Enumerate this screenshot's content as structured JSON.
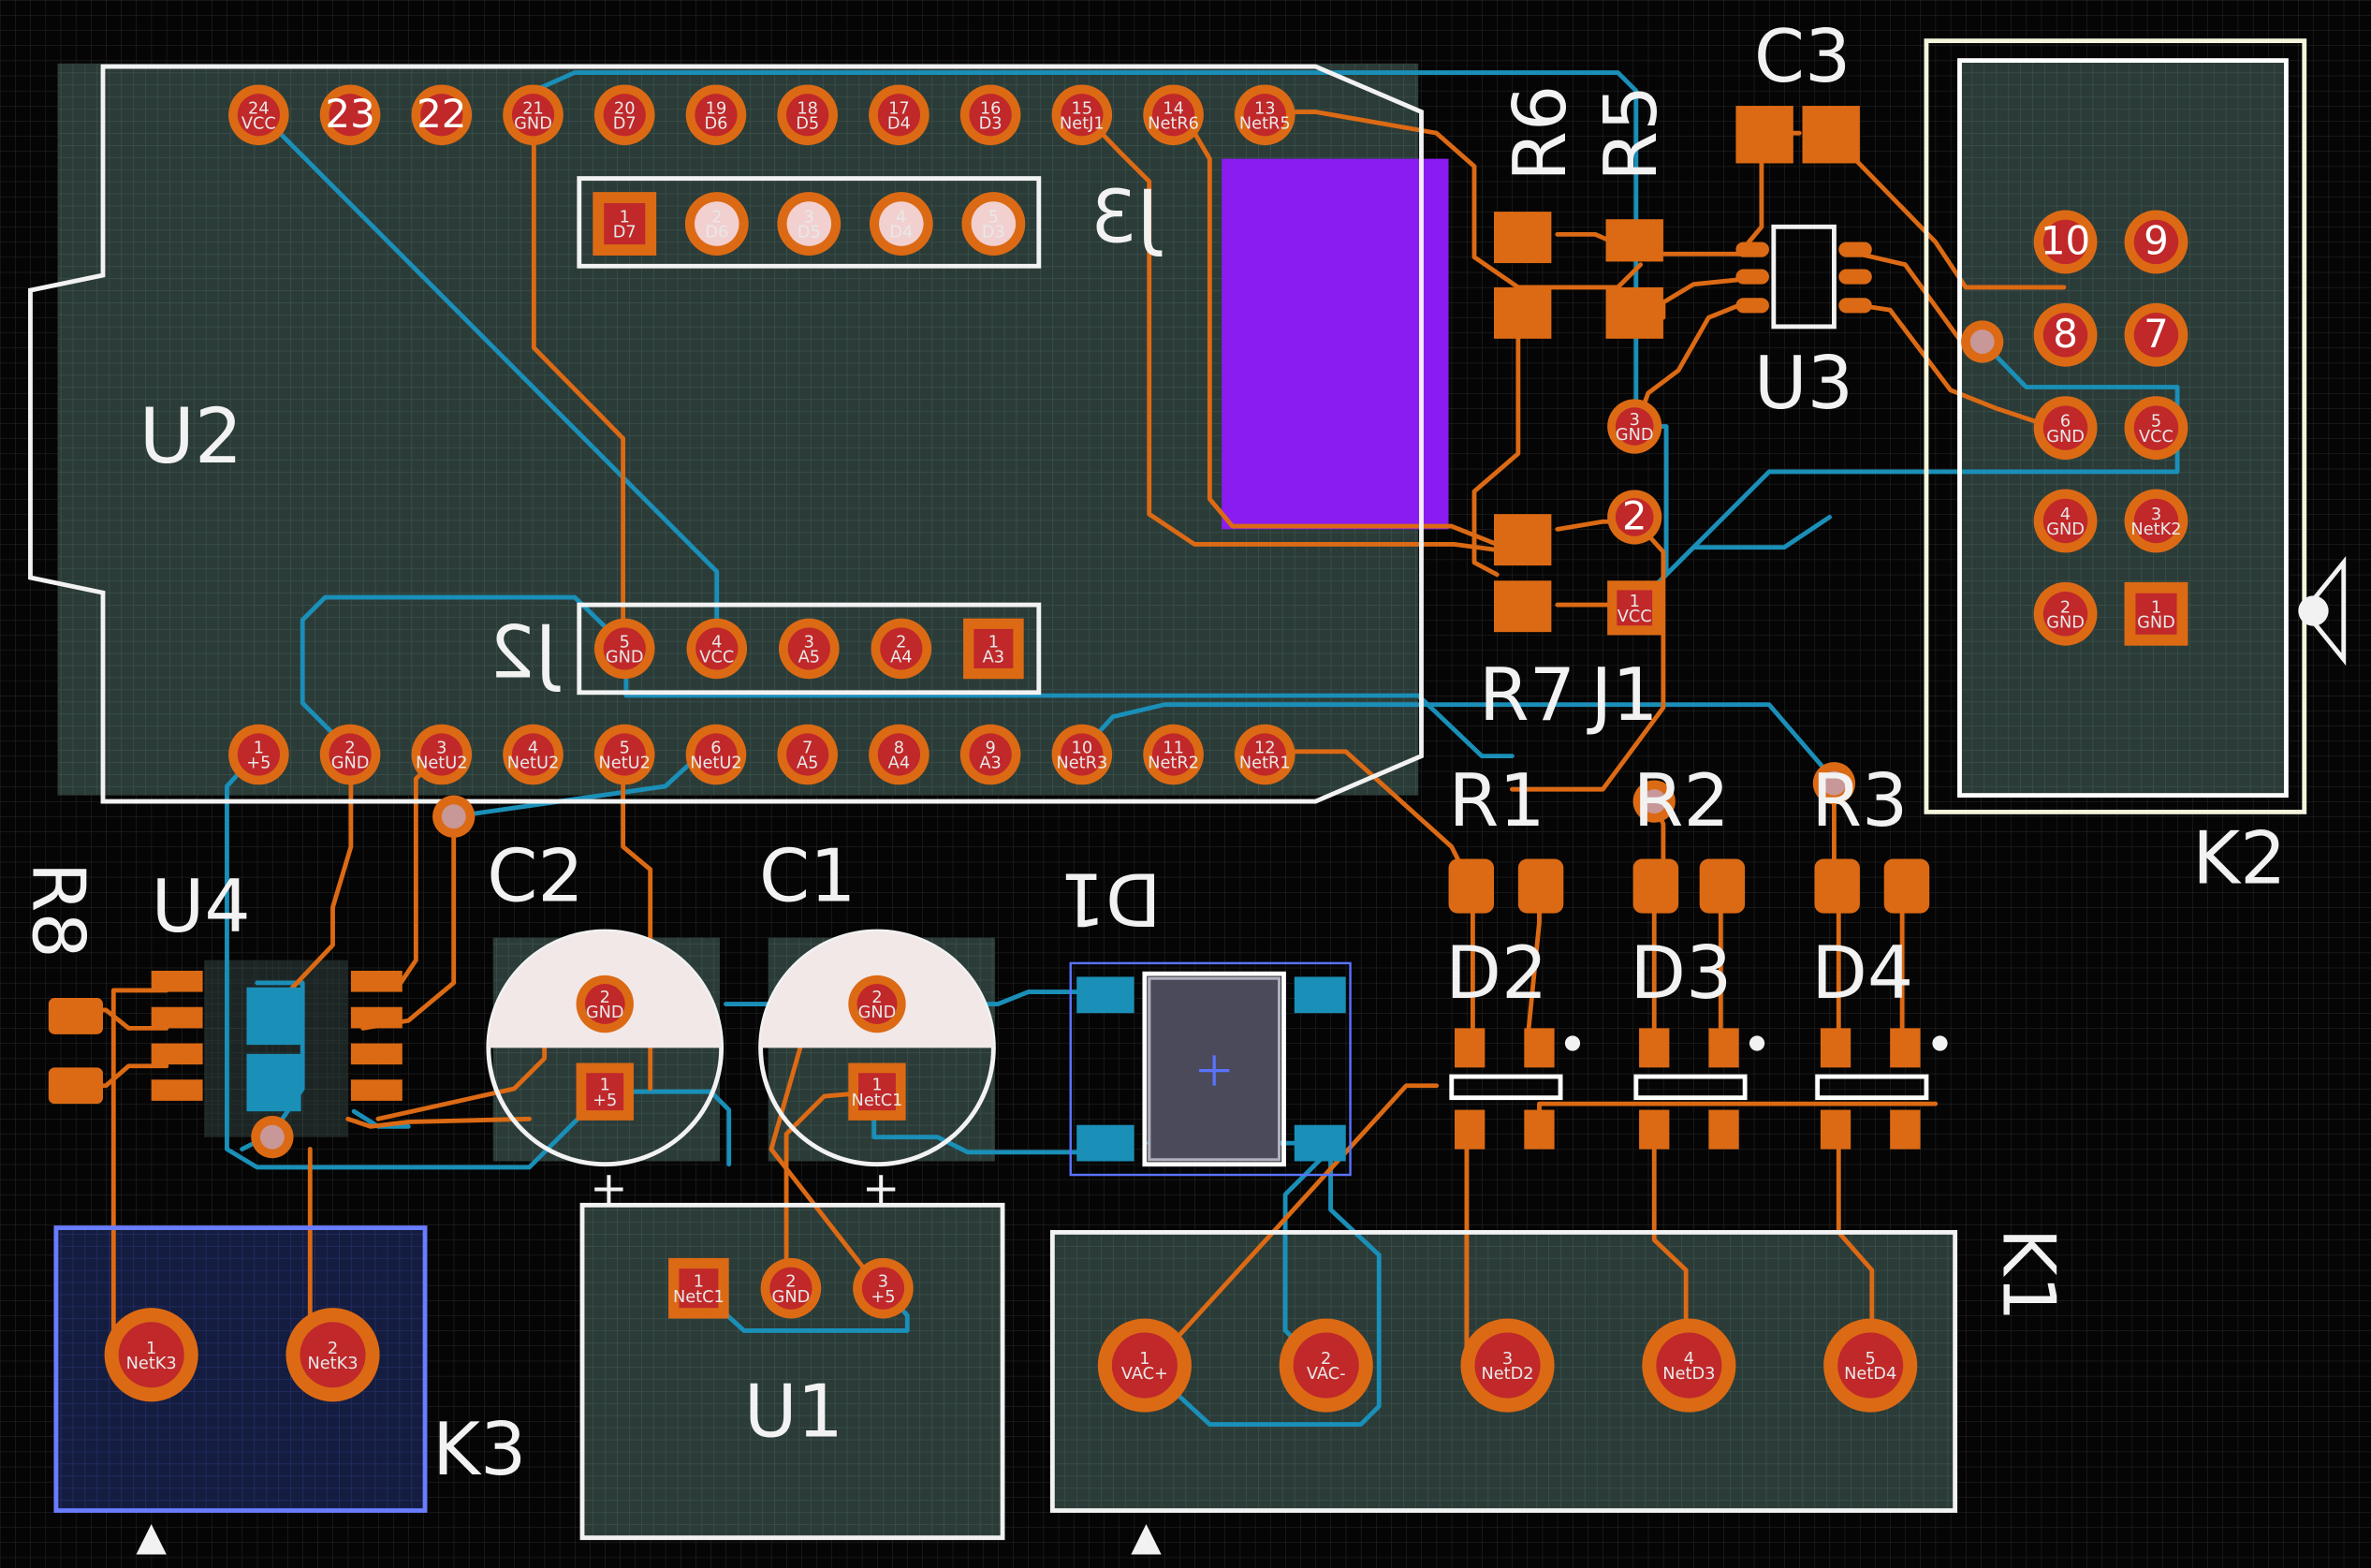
{
  "colors": {
    "background": "#000000",
    "board_fill": "#2d3e3a",
    "top_copper": "#dc6a14",
    "bottom_copper": "#1a8fb8",
    "pad": "#c0282a",
    "silkscreen": "#f2f2f2",
    "keepout": "#8a1cf2",
    "courtyard": "#5a73ff"
  },
  "designators": {
    "U2": "U2",
    "J3": "J3",
    "J2": "J2",
    "J1": "J1",
    "R6": "R6",
    "R5": "R5",
    "C3": "C3",
    "U3": "U3",
    "R7": "R7",
    "R1": "R1",
    "R2": "R2",
    "R3": "R3",
    "D2": "D2",
    "D3": "D3",
    "D4": "D4",
    "R8": "R8",
    "U4": "U4",
    "C2": "C2",
    "C1": "C1",
    "D1": "D1",
    "K1": "K1",
    "K2": "K2",
    "K3": "K3",
    "U1": "U1"
  },
  "u2_top_pins": [
    {
      "num": "24",
      "net": "VCC"
    },
    {
      "num": "23",
      "net": ""
    },
    {
      "num": "22",
      "net": ""
    },
    {
      "num": "21",
      "net": "GND"
    },
    {
      "num": "20",
      "net": "D7"
    },
    {
      "num": "19",
      "net": "D6"
    },
    {
      "num": "18",
      "net": "D5"
    },
    {
      "num": "17",
      "net": "D4"
    },
    {
      "num": "16",
      "net": "D3"
    },
    {
      "num": "15",
      "net": "NetJ1"
    },
    {
      "num": "14",
      "net": "NetR6"
    },
    {
      "num": "13",
      "net": "NetR5"
    }
  ],
  "u2_bottom_pins": [
    {
      "num": "1",
      "net": "+5"
    },
    {
      "num": "2",
      "net": "GND"
    },
    {
      "num": "3",
      "net": "NetU2"
    },
    {
      "num": "4",
      "net": "NetU2"
    },
    {
      "num": "5",
      "net": "NetU2"
    },
    {
      "num": "6",
      "net": "NetU2"
    },
    {
      "num": "7",
      "net": "A5"
    },
    {
      "num": "8",
      "net": "A4"
    },
    {
      "num": "9",
      "net": "A3"
    },
    {
      "num": "10",
      "net": "NetR3"
    },
    {
      "num": "11",
      "net": "NetR2"
    },
    {
      "num": "12",
      "net": "NetR1"
    }
  ],
  "j3_pins": [
    {
      "num": "1",
      "net": "D7"
    },
    {
      "num": "2",
      "net": "D6"
    },
    {
      "num": "3",
      "net": "D5"
    },
    {
      "num": "4",
      "net": "D4"
    },
    {
      "num": "5",
      "net": "D3"
    }
  ],
  "j2_pins": [
    {
      "num": "5",
      "net": "GND"
    },
    {
      "num": "4",
      "net": "VCC"
    },
    {
      "num": "3",
      "net": "A5"
    },
    {
      "num": "2",
      "net": "A4"
    },
    {
      "num": "1",
      "net": "A3"
    }
  ],
  "j1_pins": [
    {
      "num": "3",
      "net": "GND"
    },
    {
      "num": "2",
      "net": ""
    },
    {
      "num": "1",
      "net": "VCC"
    }
  ],
  "k2_pins": [
    {
      "num": "10",
      "net": ""
    },
    {
      "num": "9",
      "net": ""
    },
    {
      "num": "8",
      "net": ""
    },
    {
      "num": "7",
      "net": ""
    },
    {
      "num": "6",
      "net": "GND"
    },
    {
      "num": "5",
      "net": "VCC"
    },
    {
      "num": "4",
      "net": "GND"
    },
    {
      "num": "3",
      "net": "NetK2"
    },
    {
      "num": "2",
      "net": "GND"
    },
    {
      "num": "1",
      "net": "GND"
    }
  ],
  "k1_pins": [
    {
      "num": "1",
      "net": "VAC+"
    },
    {
      "num": "2",
      "net": "VAC-"
    },
    {
      "num": "3",
      "net": "NetD2"
    },
    {
      "num": "4",
      "net": "NetD3"
    },
    {
      "num": "5",
      "net": "NetD4"
    }
  ],
  "k3_pins": [
    {
      "num": "1",
      "net": "NetK3"
    },
    {
      "num": "2",
      "net": "NetK3"
    }
  ],
  "u1_pins": [
    {
      "num": "1",
      "net": "NetC1"
    },
    {
      "num": "2",
      "net": "GND"
    },
    {
      "num": "3",
      "net": "+5"
    }
  ],
  "c1_pins": [
    {
      "num": "2",
      "net": "GND"
    },
    {
      "num": "1",
      "net": "NetC1"
    }
  ],
  "c2_pins": [
    {
      "num": "2",
      "net": "GND"
    },
    {
      "num": "1",
      "net": "+5"
    }
  ],
  "cap_polarity": "+"
}
